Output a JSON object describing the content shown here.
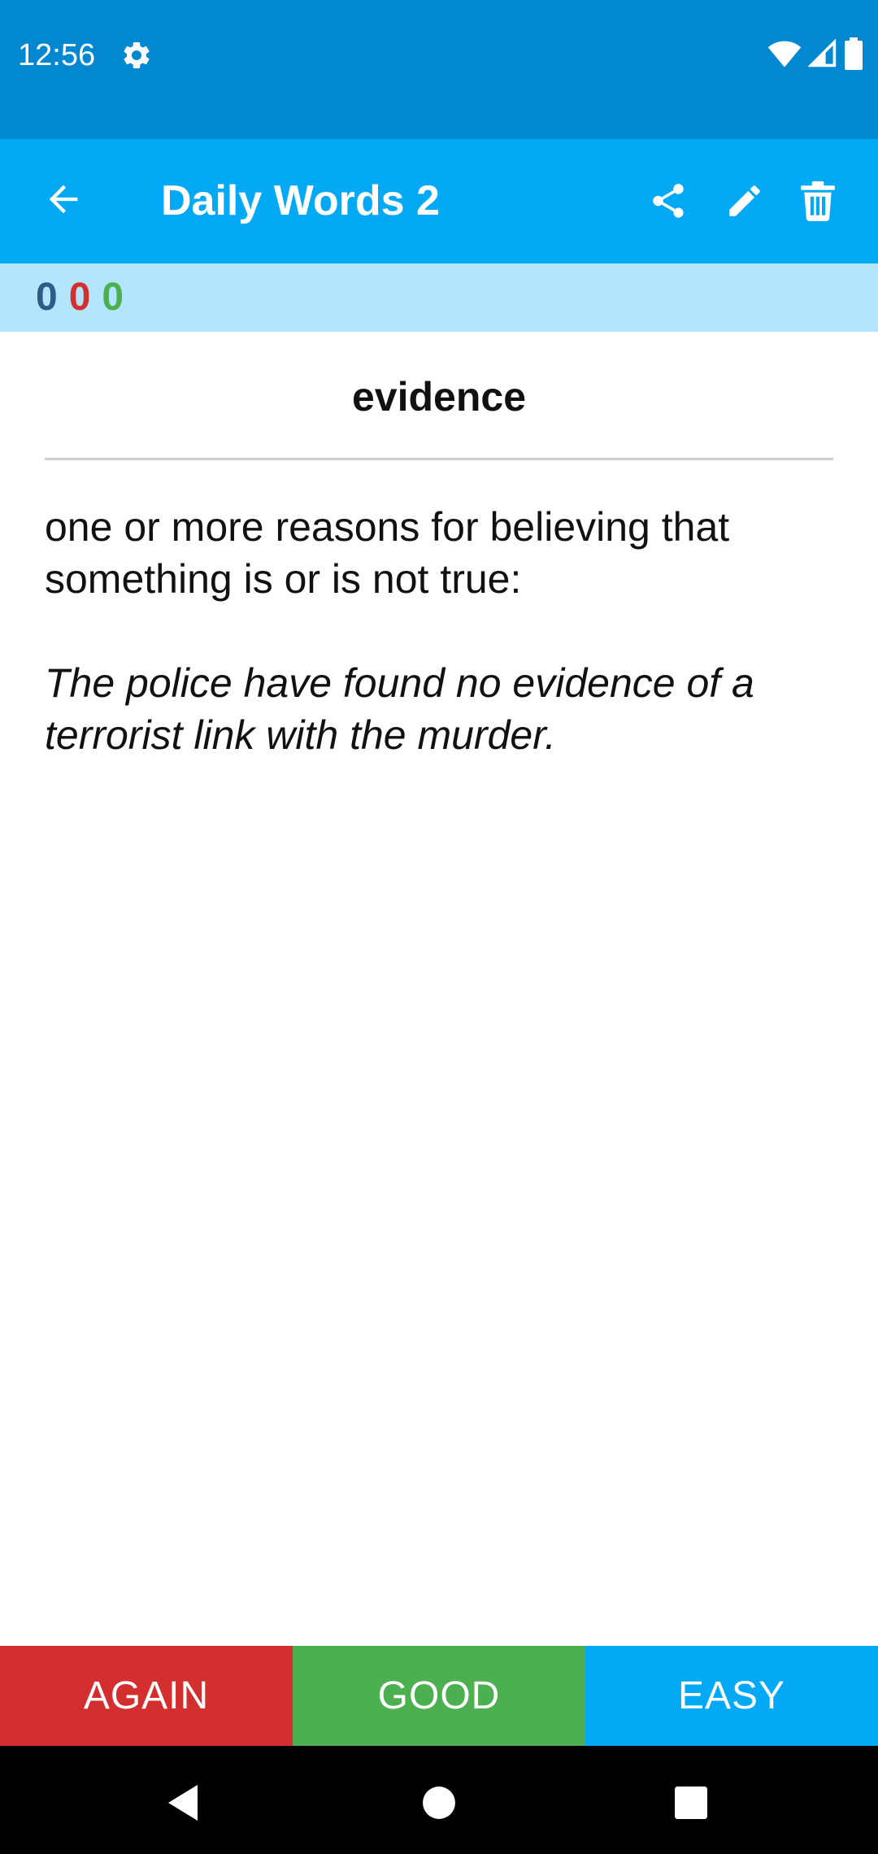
{
  "status_bar": {
    "time": "12:56",
    "icons": [
      "settings-icon",
      "wifi-icon",
      "cell-signal-icon",
      "battery-icon"
    ]
  },
  "app_bar": {
    "title": "Daily Words 2",
    "icons": [
      "back-arrow-icon",
      "share-icon",
      "edit-pencil-icon",
      "delete-trash-icon"
    ]
  },
  "counts": {
    "new": "0",
    "learning": "0",
    "review": "0"
  },
  "card": {
    "word": "evidence",
    "definition": "one or more reasons for believing that something is or is not true:",
    "example": "The police have found no evidence of a terrorist link with the murder."
  },
  "answers": {
    "again": "AGAIN",
    "good": "GOOD",
    "easy": "EASY"
  },
  "colors": {
    "status_bar": "#0288d1",
    "app_bar": "#03a9f4",
    "counts_bar": "#b3e5fc",
    "again": "#d32f2f",
    "good": "#4caf50",
    "easy": "#03a9f4"
  },
  "nav_bar": {
    "icons": [
      "nav-back-icon",
      "nav-home-icon",
      "nav-recents-icon"
    ]
  }
}
